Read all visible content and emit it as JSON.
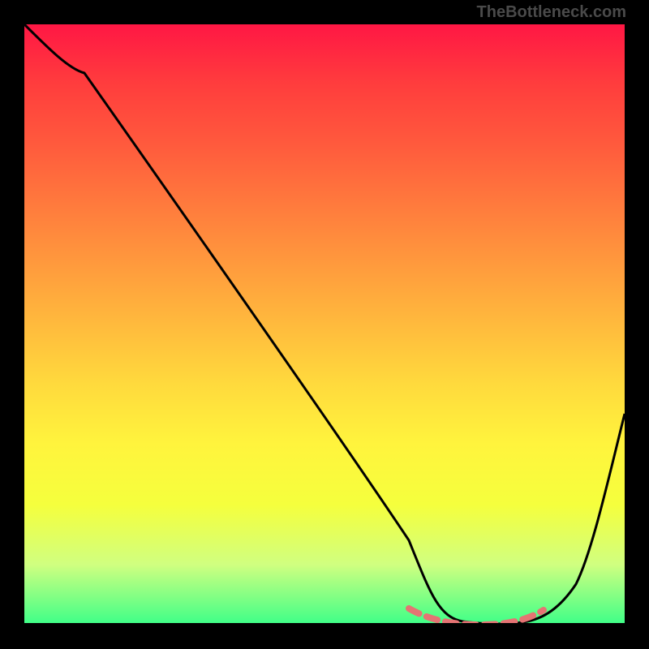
{
  "attribution": "TheBottleneck.com",
  "chart_data": {
    "type": "line",
    "title": "",
    "xlabel": "",
    "ylabel": "",
    "xlim": [
      0,
      100
    ],
    "ylim": [
      0,
      100
    ],
    "series": [
      {
        "name": "bottleneck-curve",
        "x": [
          0,
          5,
          10,
          20,
          30,
          40,
          50,
          60,
          64,
          68,
          72,
          76,
          80,
          84,
          88,
          92,
          96,
          100
        ],
        "values": [
          100,
          96,
          92,
          80,
          67,
          54,
          41,
          27,
          14,
          6,
          1,
          0,
          0,
          0,
          1,
          6,
          18,
          35
        ]
      },
      {
        "name": "optimal-zone",
        "x": [
          64,
          68,
          72,
          76,
          80,
          84,
          88
        ],
        "values": [
          2,
          1,
          0,
          0,
          0,
          1,
          2
        ]
      }
    ],
    "gradient_stops": [
      {
        "pct": 0,
        "color": "#ff1744"
      },
      {
        "pct": 50,
        "color": "#ffda3d"
      },
      {
        "pct": 100,
        "color": "#3dff88"
      }
    ]
  }
}
